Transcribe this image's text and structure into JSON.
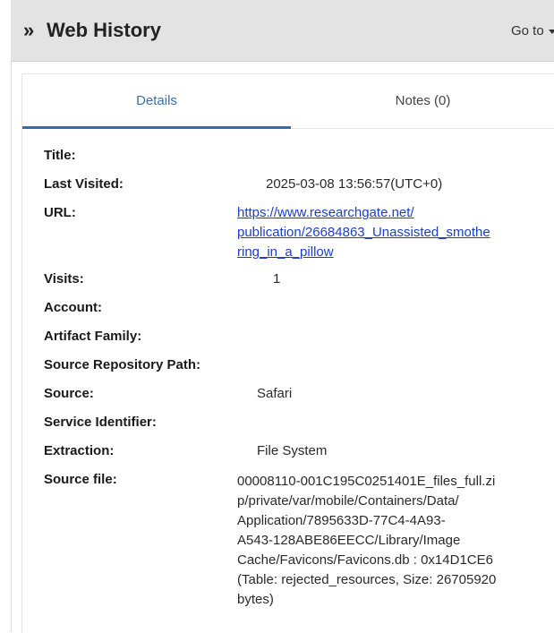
{
  "header": {
    "chevron": "»",
    "title": "Web History",
    "goto_label": "Go to"
  },
  "tabs": [
    {
      "label": "Details",
      "active": true
    },
    {
      "label": "Notes (0)",
      "active": false
    }
  ],
  "fields": {
    "title": {
      "label": "Title:",
      "value": ""
    },
    "last_visited": {
      "label": "Last Visited:",
      "value": "2025-03-08 13:56:57(UTC+0)"
    },
    "url": {
      "label": "URL:",
      "value_lines": [
        "https://www.researchgate.net/",
        "publication/26684863_Unassisted_smothe",
        "ring_in_a_pillow"
      ]
    },
    "visits": {
      "label": "Visits:",
      "value": "1"
    },
    "account": {
      "label": "Account:",
      "value": ""
    },
    "artifact_family": {
      "label": "Artifact Family:",
      "value": ""
    },
    "source_repository_path": {
      "label": "Source Repository Path:",
      "value": ""
    },
    "source": {
      "label": "Source:",
      "value": "Safari"
    },
    "service_identifier": {
      "label": "Service Identifier:",
      "value": ""
    },
    "extraction": {
      "label": "Extraction:",
      "value": "File System"
    },
    "source_file": {
      "label": "Source file:",
      "value_lines": [
        "00008110-001C195C0251401E_files_full.zi",
        "p/private/var/mobile/Containers/Data/",
        "Application/7895633D-77C4-4A93-",
        "A543-128ABE86EECC/Library/Image",
        "Cache/Favicons/Favicons.db : 0x14D1CE6",
        "(Table: rejected_resources, Size: 26705920",
        "bytes)"
      ]
    }
  },
  "colors": {
    "header_bg": "#e3e3e3",
    "active_tab_text": "#3d6fa6",
    "active_tab_underline": "#2f6db3",
    "link": "#1a3fc7"
  }
}
